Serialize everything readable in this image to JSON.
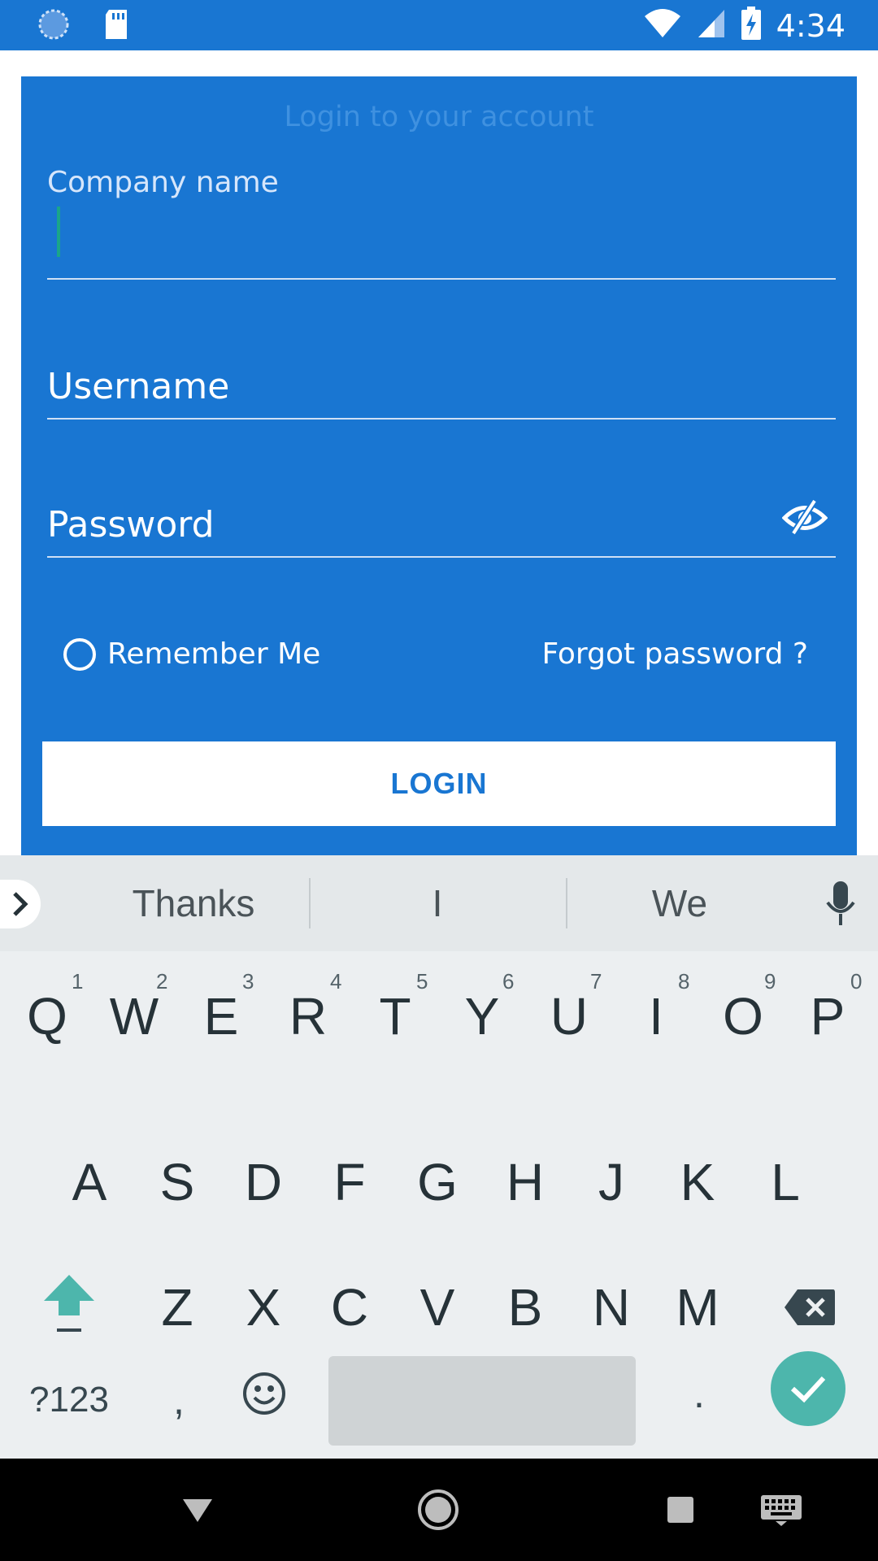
{
  "status_bar": {
    "time": "4:34",
    "icons": [
      "sync-icon",
      "sd-card-icon",
      "wifi-icon",
      "signal-icon",
      "battery-charging-icon"
    ]
  },
  "login": {
    "title": "Login to your account",
    "company_label": "Company name",
    "username_label": "Username",
    "password_label": "Password",
    "remember_label": "Remember Me",
    "forgot_label": "Forgot password ?",
    "login_button": "LOGIN",
    "colors": {
      "primary": "#1976d2",
      "button_bg": "#ffffff",
      "cursor": "#1aa58a"
    }
  },
  "keyboard": {
    "suggestions": [
      "Thanks",
      "I",
      "We"
    ],
    "row1": [
      "Q",
      "W",
      "E",
      "R",
      "T",
      "Y",
      "U",
      "I",
      "O",
      "P"
    ],
    "row1_hints": [
      "1",
      "2",
      "3",
      "4",
      "5",
      "6",
      "7",
      "8",
      "9",
      "0"
    ],
    "row2": [
      "A",
      "S",
      "D",
      "F",
      "G",
      "H",
      "J",
      "K",
      "L"
    ],
    "row3": [
      "Z",
      "X",
      "C",
      "V",
      "B",
      "N",
      "M"
    ],
    "symbols_key": "?123",
    "comma_key": ",",
    "period_key": ".",
    "accent": "#4db6ac"
  },
  "nav_bar": {
    "icons": [
      "back-icon",
      "home-icon",
      "recents-icon",
      "keyboard-switch-icon"
    ]
  }
}
